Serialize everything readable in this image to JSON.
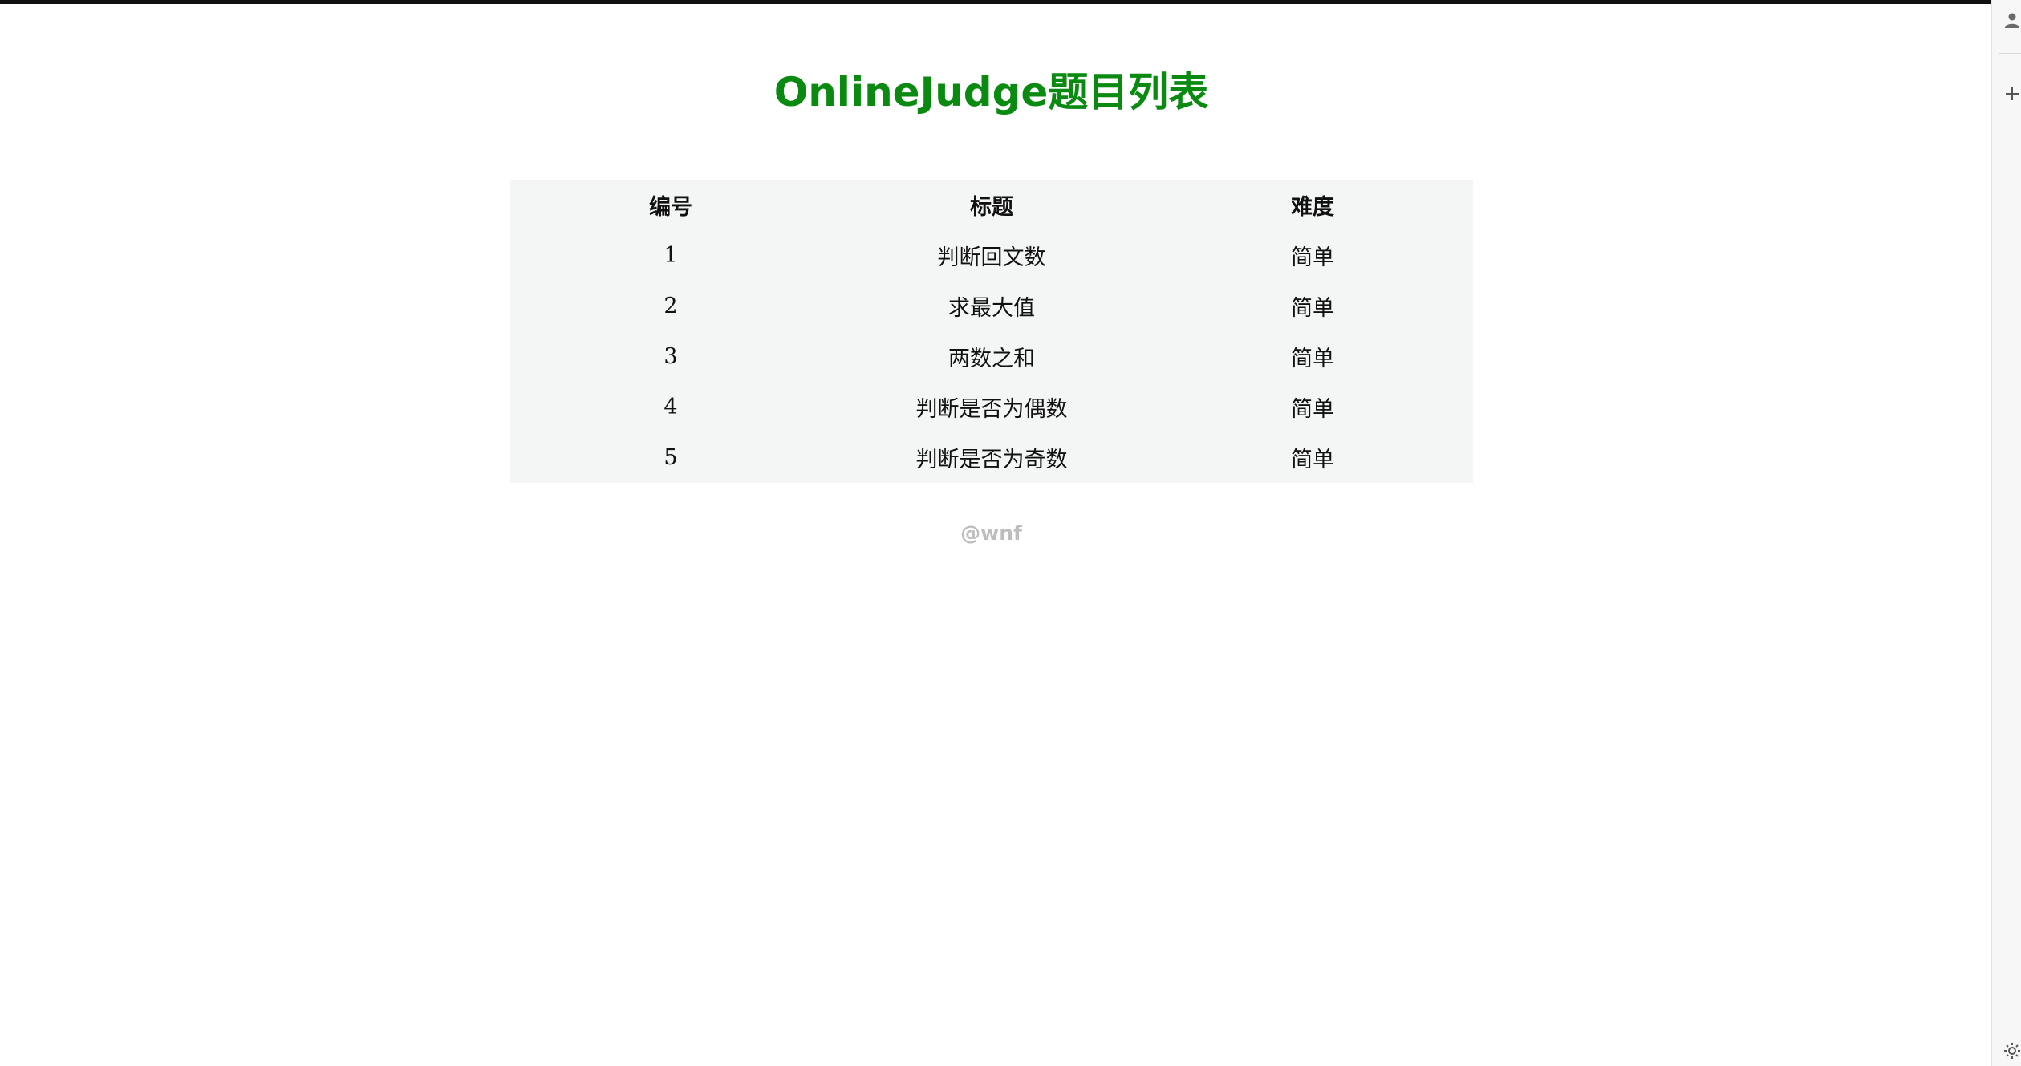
{
  "page": {
    "title": "OnlineJudge题目列表",
    "footer": "@wnf"
  },
  "table": {
    "headers": {
      "id": "编号",
      "title": "标题",
      "difficulty": "难度"
    },
    "rows": [
      {
        "id": "1",
        "title": "判断回文数",
        "difficulty": "简单"
      },
      {
        "id": "2",
        "title": "求最大值",
        "difficulty": "简单"
      },
      {
        "id": "3",
        "title": "两数之和",
        "difficulty": "简单"
      },
      {
        "id": "4",
        "title": "判断是否为偶数",
        "difficulty": "简单"
      },
      {
        "id": "5",
        "title": "判断是否为奇数",
        "difficulty": "简单"
      }
    ]
  },
  "colors": {
    "title": "#0a8a10",
    "table_background": "#f3f6f4",
    "footer": "#bdbdbd"
  },
  "sidebar": {
    "icons": [
      "profile-icon",
      "plus-icon",
      "settings-icon"
    ]
  }
}
